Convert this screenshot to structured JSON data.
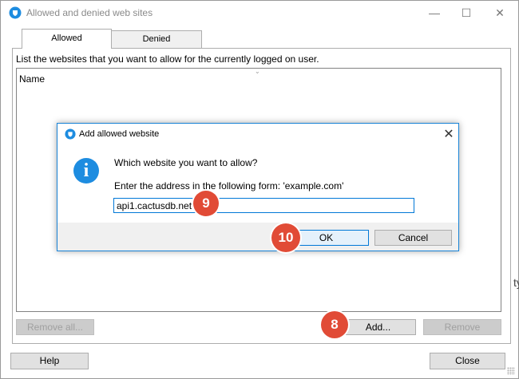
{
  "window": {
    "title": "Allowed and denied web sites",
    "controls": {
      "minimize": "—",
      "maximize": "☐",
      "close": "✕"
    }
  },
  "tabs": [
    {
      "label": "Allowed",
      "active": true
    },
    {
      "label": "Denied",
      "active": false
    }
  ],
  "panel": {
    "description": "List the websites that you want to allow for the currently logged on user.",
    "column_header": "Name",
    "buttons": {
      "remove_all": "Remove all...",
      "add": "Add...",
      "remove": "Remove"
    }
  },
  "footer": {
    "help": "Help",
    "close": "Close"
  },
  "dialog": {
    "title": "Add allowed website",
    "close": "✕",
    "question": "Which website you want to allow?",
    "hint": "Enter the address in the following form: 'example.com'",
    "input_value": "api1.cactusdb.net",
    "ok": "OK",
    "cancel": "Cancel"
  },
  "badges": {
    "add": "8",
    "input": "9",
    "ok": "10"
  },
  "edge_text": "ty",
  "colors": {
    "accent": "#0078d7",
    "badge": "#e14b36",
    "info_icon": "#1d8ce0"
  }
}
